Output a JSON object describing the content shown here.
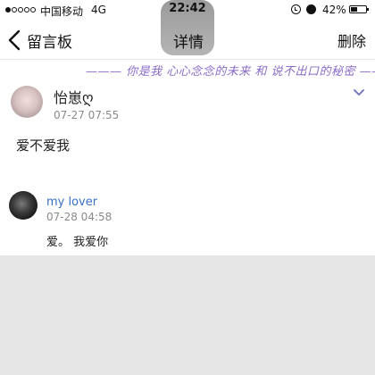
{
  "status_bar": {
    "carrier": "中国移动",
    "network": "4G",
    "time": "22:42",
    "battery_percent": "42%",
    "battery_level": 0.42
  },
  "nav": {
    "back_label": "留言板",
    "title": "详情",
    "delete_label": "删除"
  },
  "banner": {
    "text": "——— 你是我 心心念念的未来 和 说不出口的秘密 ———"
  },
  "post": {
    "author": "怡崽ღ",
    "time": "07-27 07:55",
    "body": "爱不爱我"
  },
  "reply": {
    "author": "my lover",
    "time": "07-28 04:58",
    "body": "爱。 我爱你"
  },
  "colors": {
    "link_blue": "#3b6fc4",
    "banner_purple": "#8a6cc8",
    "background": "#e6e6e6"
  },
  "icons": [
    "signal-dots",
    "lock-icon",
    "alarm-icon",
    "battery-icon",
    "back-chevron-icon",
    "chevron-down-icon"
  ]
}
